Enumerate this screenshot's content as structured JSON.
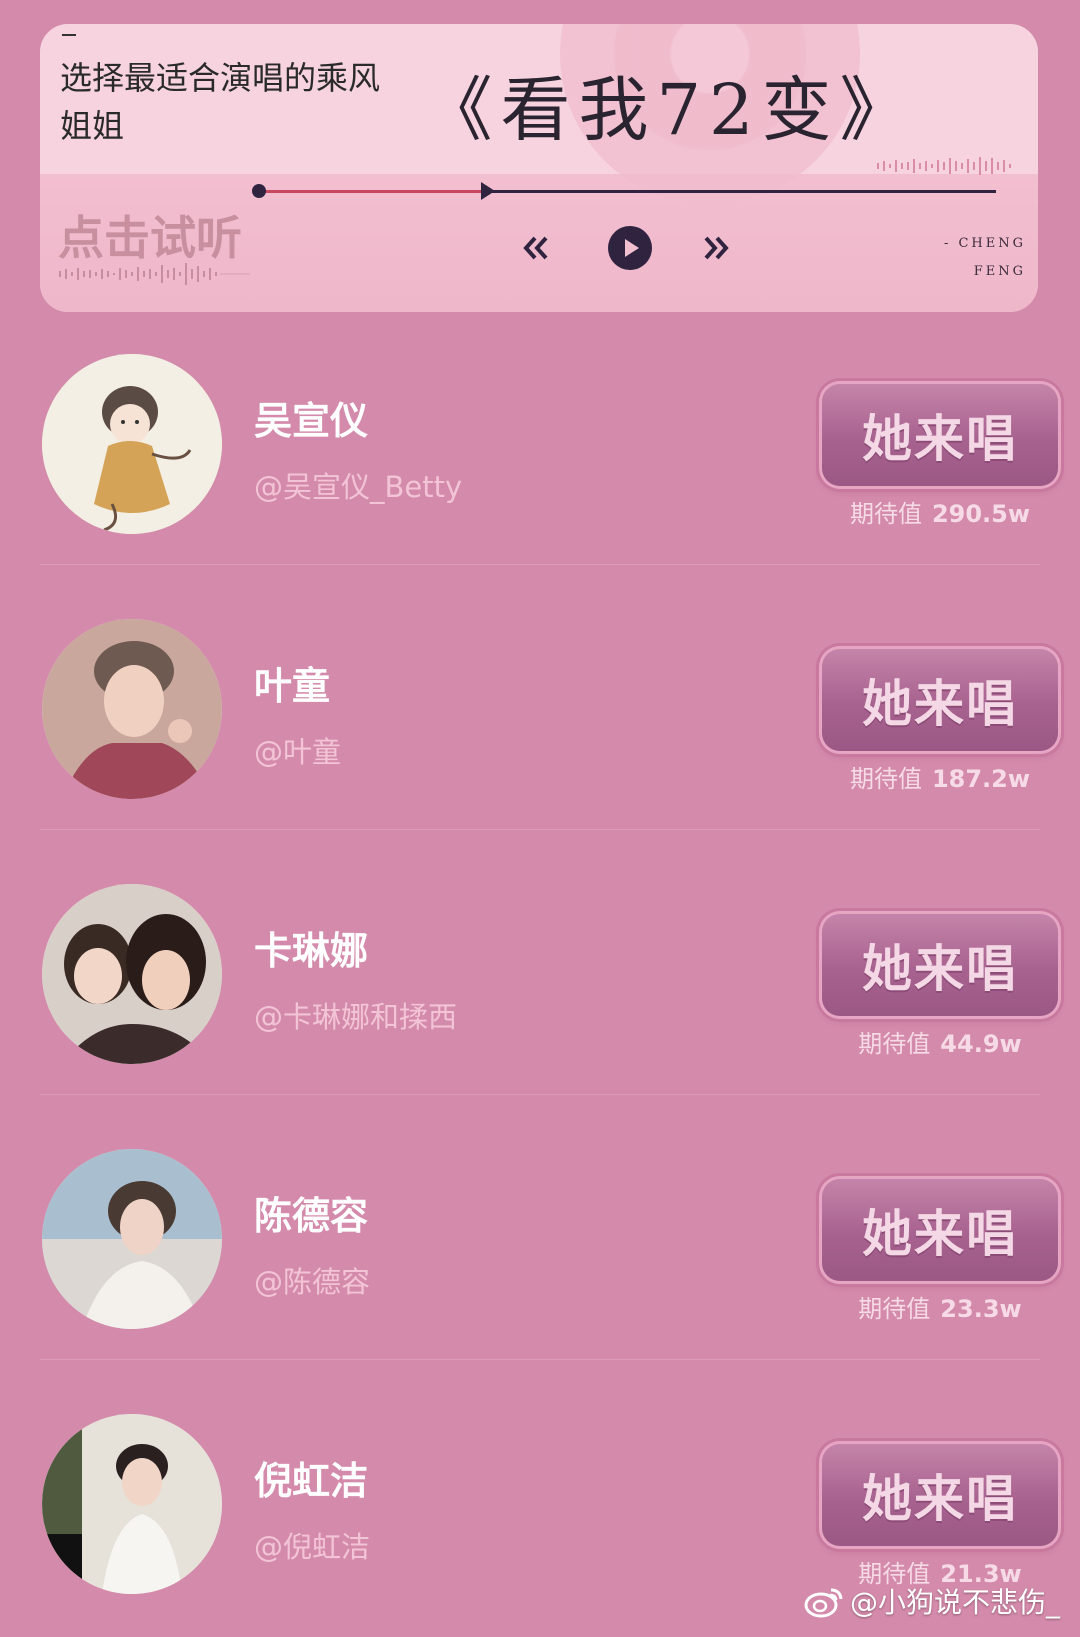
{
  "player": {
    "prompt": "选择最适合演唱的乘风姐姐",
    "song_title": "《看我72变》",
    "listen_label": "点击试听",
    "credit_line1": "- CHENG",
    "credit_line2": "FENG",
    "progress": 0.3,
    "icons": {
      "prev": "double-chevron-left-icon",
      "play": "play-icon",
      "next": "double-chevron-right-icon"
    }
  },
  "singers": [
    {
      "name": "吴宣仪",
      "handle": "@吴宣仪_Betty",
      "button_label": "她来唱",
      "expect_label": "期待值",
      "expect_value": "290.5w"
    },
    {
      "name": "叶童",
      "handle": "@叶童",
      "button_label": "她来唱",
      "expect_label": "期待值",
      "expect_value": "187.2w"
    },
    {
      "name": "卡琳娜",
      "handle": "@卡琳娜和揉西",
      "button_label": "她来唱",
      "expect_label": "期待值",
      "expect_value": "44.9w"
    },
    {
      "name": "陈德容",
      "handle": "@陈德容",
      "button_label": "她来唱",
      "expect_label": "期待值",
      "expect_value": "23.3w"
    },
    {
      "name": "倪虹洁",
      "handle": "@倪虹洁",
      "button_label": "她来唱",
      "expect_label": "期待值",
      "expect_value": "21.3w"
    }
  ],
  "watermark": {
    "text": "@小狗说不悲伤_",
    "icon": "weibo-icon"
  },
  "colors": {
    "background": "#d48aaa",
    "card": "#f6d3de",
    "button": "#a7628f",
    "dark": "#2f2340"
  }
}
